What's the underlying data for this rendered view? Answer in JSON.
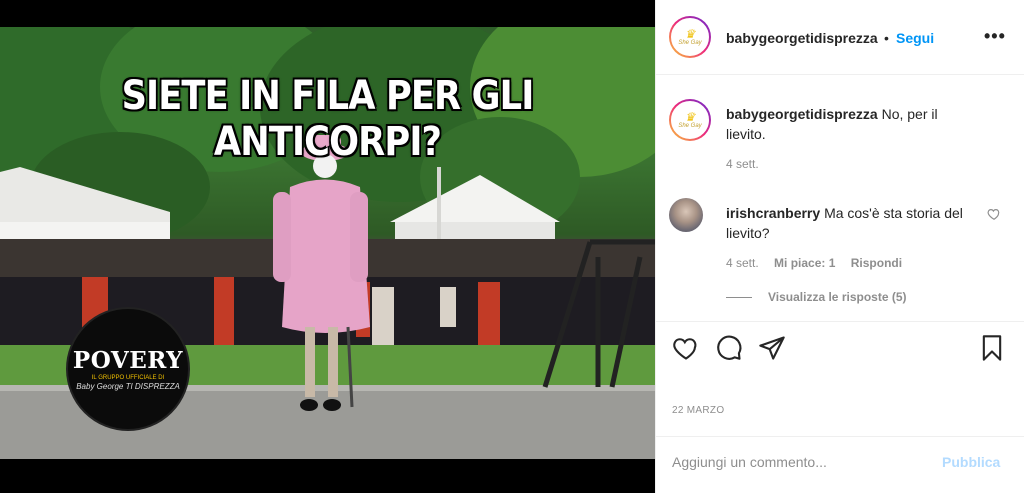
{
  "post": {
    "meme_caption": "SIETE IN FILA PER GLI ANTICORPI?",
    "logo": {
      "title": "POVERY",
      "subtitle": "IL GRUPPO UFFICIALE DI",
      "signature": "Baby George TI DISPREZZA"
    }
  },
  "header": {
    "username": "babygeorgetidisprezza",
    "separator": "•",
    "follow_label": "Segui",
    "more_icon": "more-horizontal-icon"
  },
  "avatar_text": "She Gay",
  "comments": [
    {
      "username": "babygeorgetidisprezza",
      "text": "No, per il lievito.",
      "time": "4 sett."
    },
    {
      "username": "irishcranberry",
      "text": "Ma cos'è sta storia del lievito?",
      "time": "4 sett.",
      "likes": "Mi piace: 1",
      "reply_label": "Rispondi",
      "view_replies": "Visualizza le risposte (5)"
    }
  ],
  "actions": {
    "like_icon": "heart-icon",
    "comment_icon": "comment-icon",
    "share_icon": "send-icon",
    "save_icon": "bookmark-icon"
  },
  "date": "22 MARZO",
  "add_comment": {
    "placeholder": "Aggiungi un commento...",
    "publish_label": "Pubblica"
  }
}
